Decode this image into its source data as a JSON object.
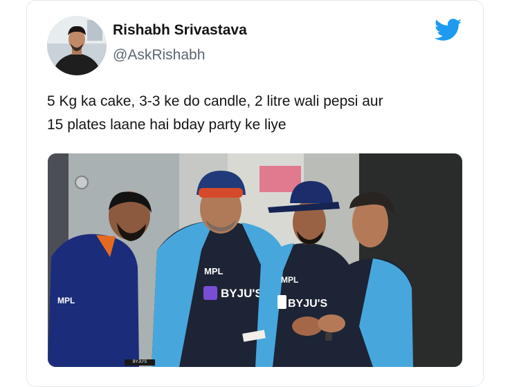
{
  "tweet": {
    "author": {
      "display_name": "Rishabh Srivastava",
      "handle": "@AskRishabh",
      "avatar_icon": "profile-avatar"
    },
    "platform_icon": "twitter-bird-icon",
    "text_lines": [
      "5 Kg ka cake, 3-3 ke do candle, 2 litre wali pepsi aur",
      "15 plates laane hai bday party ke liye"
    ],
    "media": {
      "jersey_texts": [
        "MPL",
        "BYJU'S",
        "MPL",
        "BYJU'S",
        "MPL"
      ],
      "sign_text": "BYJU'S"
    }
  },
  "colors": {
    "twitter_blue": "#1d9bf0",
    "text_primary": "#141414",
    "text_secondary": "#5b6670",
    "card_border": "#e3e7ea"
  }
}
